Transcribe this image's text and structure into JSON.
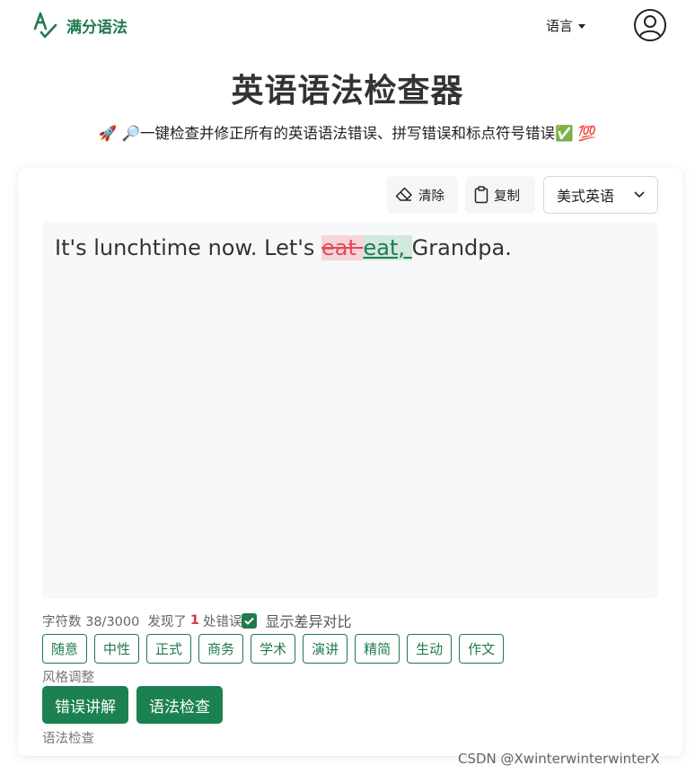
{
  "header": {
    "brand": "满分语法",
    "language_menu": "语言"
  },
  "page": {
    "title": "英语语法检查器",
    "subtitle": "🚀 🔎一键检查并修正所有的英语语法错误、拼写错误和标点符号错误✅ 💯"
  },
  "toolbar": {
    "clear_label": "清除",
    "copy_label": "复制",
    "dialect_selected": "美式英语"
  },
  "editor": {
    "text_before": "It's lunchtime now. Let's ",
    "deleted": "eat ",
    "inserted": "eat, ",
    "text_after": "Grandpa."
  },
  "stats": {
    "char_count_label": "字符数 38/3000",
    "found_prefix": "发现了",
    "error_count": "1",
    "found_suffix": "处错误",
    "diff_toggle_label": "显示差异对比",
    "diff_toggle_checked": true
  },
  "styles": {
    "options": [
      "随意",
      "中性",
      "正式",
      "商务",
      "学术",
      "演讲",
      "精简",
      "生动",
      "作文"
    ],
    "caption": "风格调整"
  },
  "actions": {
    "explain_label": "错误讲解",
    "check_label": "语法检查",
    "caption": "语法检查"
  },
  "watermark": "CSDN @XwinterwinterwinterX",
  "colors": {
    "brand": "#1f7a4d",
    "error": "#dc3545",
    "deleted_bg": "#f6d5d8",
    "inserted_bg": "#d2e9dd"
  }
}
